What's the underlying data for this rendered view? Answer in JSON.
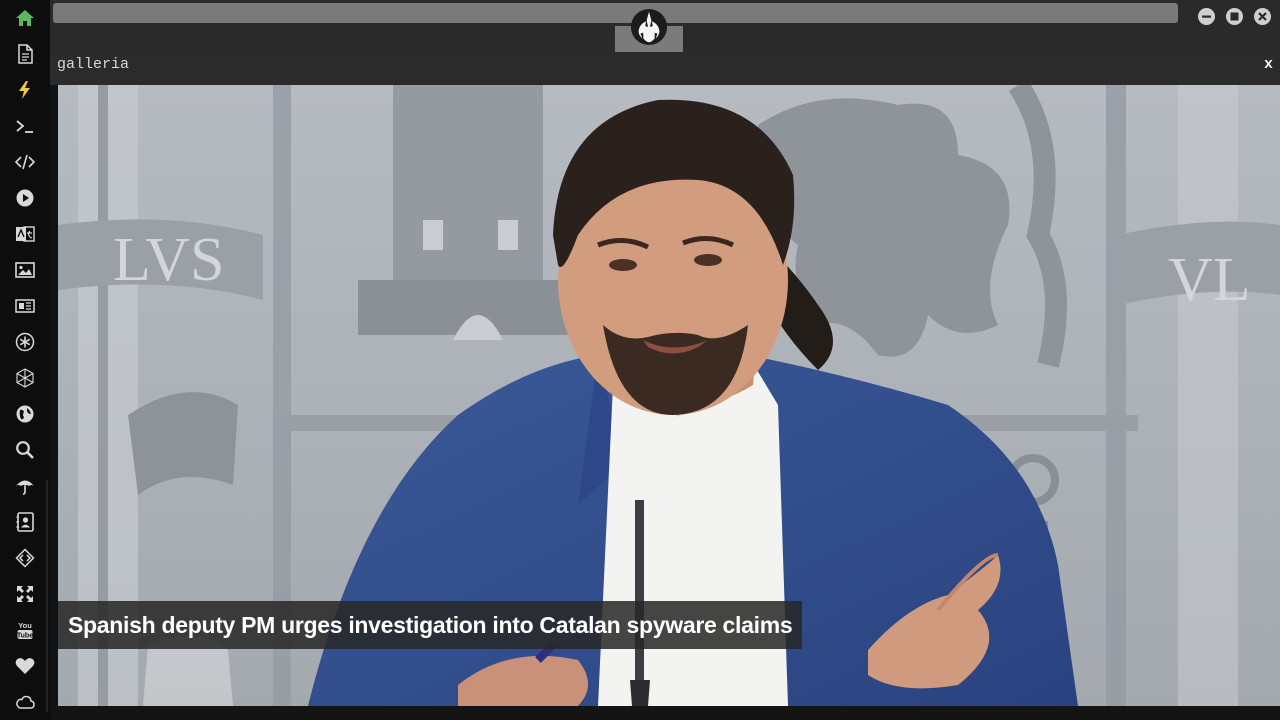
{
  "window": {
    "title": "galleria",
    "close_label": "x"
  },
  "gallery": {
    "caption": "Spanish deputy PM urges investigation into Catalan spyware claims"
  },
  "photo_text": {
    "left_motto": "LVS",
    "right_motto": "VL"
  },
  "sidebar": {
    "items": [
      {
        "icon": "home-icon",
        "active": true
      },
      {
        "icon": "document-icon"
      },
      {
        "icon": "lightning-icon"
      },
      {
        "icon": "terminal-icon"
      },
      {
        "icon": "code-icon"
      },
      {
        "icon": "play-icon"
      },
      {
        "icon": "translate-icon"
      },
      {
        "icon": "image-icon"
      },
      {
        "icon": "newspaper-icon"
      },
      {
        "icon": "asterisk-icon"
      },
      {
        "icon": "cube-network-icon"
      },
      {
        "icon": "globe-icon"
      },
      {
        "icon": "search-icon"
      },
      {
        "icon": "umbrella-icon"
      },
      {
        "icon": "contacts-icon"
      },
      {
        "icon": "diamond-code-icon"
      },
      {
        "icon": "expand-icon"
      },
      {
        "icon": "youtube-icon"
      },
      {
        "icon": "heart-icon"
      },
      {
        "icon": "cloud-icon"
      }
    ]
  },
  "colors": {
    "accent_active": "#5cb85c",
    "icon_default": "#d9d9d9"
  }
}
